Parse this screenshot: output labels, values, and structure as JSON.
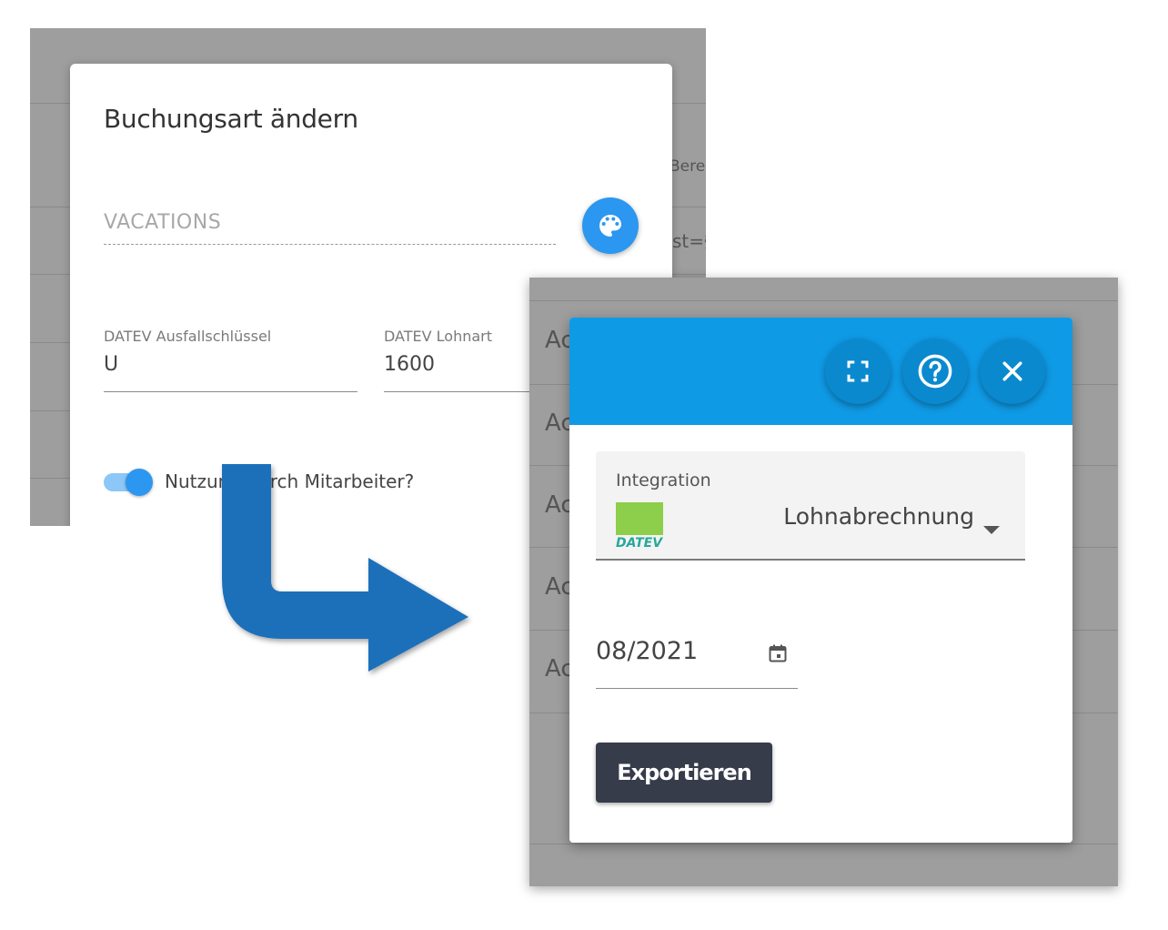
{
  "left_dialog": {
    "title": "Buchungsart ändern",
    "name_field": {
      "placeholder": "VACATIONS"
    },
    "palette_button": {
      "icon": "palette-icon",
      "color": "#2b97f0"
    },
    "ausfall_field": {
      "label": "DATEV Ausfallschlüssel",
      "value": "U"
    },
    "lohnart_field": {
      "label": "DATEV Lohnart",
      "value": "1600"
    },
    "toggle": {
      "label": "Nutzung durch Mitarbeiter?",
      "checked": true
    }
  },
  "left_background": {
    "text_1": "Bere",
    "text_2": "st=§"
  },
  "right_background": {
    "rows": [
      "Ac",
      "Ac",
      "Ac",
      "Ac",
      "Ac"
    ]
  },
  "right_dialog": {
    "header_color": "#0f9ae6",
    "header_buttons": [
      {
        "icon": "fullscreen-icon"
      },
      {
        "icon": "help-icon"
      },
      {
        "icon": "close-icon"
      }
    ],
    "integration": {
      "label": "Integration",
      "logo_text": "DATEV",
      "value": "Lohnabrechnung"
    },
    "date": {
      "value": "08/2021",
      "icon": "calendar-icon"
    },
    "export_button": {
      "label": "Exportieren"
    }
  },
  "arrow": {
    "color": "#1f6fba",
    "icon": "arrow-down-right-icon"
  }
}
